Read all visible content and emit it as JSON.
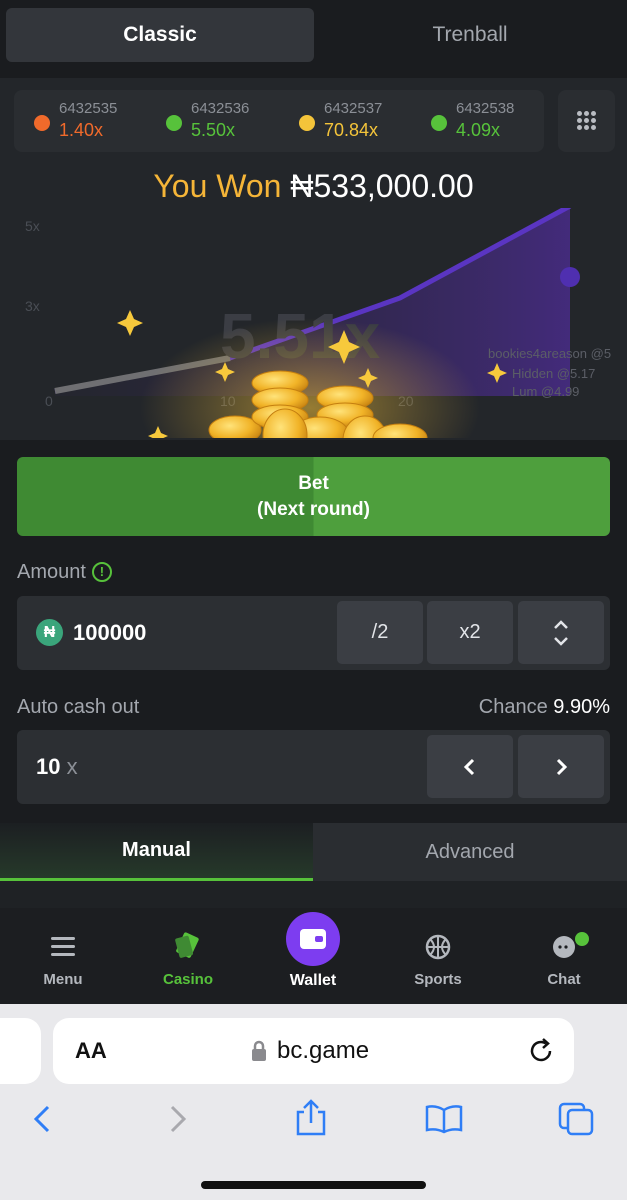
{
  "tabs": {
    "classic": "Classic",
    "trenball": "Trenball"
  },
  "history": [
    {
      "id": "6432535",
      "multiplier": "1.40x",
      "color": "#f06a2b"
    },
    {
      "id": "6432536",
      "multiplier": "5.50x",
      "color": "#57c23b"
    },
    {
      "id": "6432537",
      "multiplier": "70.84x",
      "color": "#f4c43a"
    },
    {
      "id": "6432538",
      "multiplier": "4.09x",
      "color": "#57c23b"
    }
  ],
  "game": {
    "won_label": "You Won",
    "won_amount": "₦533,000.00",
    "crash_multiplier": "5.51x",
    "y_ticks": [
      "5x",
      "3x",
      "0"
    ],
    "x_ticks": [
      "10",
      "20"
    ],
    "players": [
      "bookies4areason @5",
      "Hidden @5.17",
      "Lum @4.99"
    ]
  },
  "bet_button": {
    "line1": "Bet",
    "line2": "(Next round)"
  },
  "amount": {
    "label": "Amount",
    "currency_symbol": "₦",
    "value": "100000",
    "half": "/2",
    "double": "x2"
  },
  "auto_cash_out": {
    "label": "Auto cash out",
    "value": "10",
    "suffix": "x",
    "chance_label": "Chance",
    "chance_value": "9.90%"
  },
  "modes": {
    "manual": "Manual",
    "advanced": "Advanced"
  },
  "nav": {
    "menu": "Menu",
    "casino": "Casino",
    "wallet": "Wallet",
    "sports": "Sports",
    "chat": "Chat"
  },
  "browser": {
    "text_size": "AA",
    "url": "bc.game"
  },
  "colors": {
    "accent_green": "#57c23b",
    "gold": "#f5b538",
    "wallet_purple": "#7d3df0",
    "ios_blue": "#2f7ef6"
  }
}
